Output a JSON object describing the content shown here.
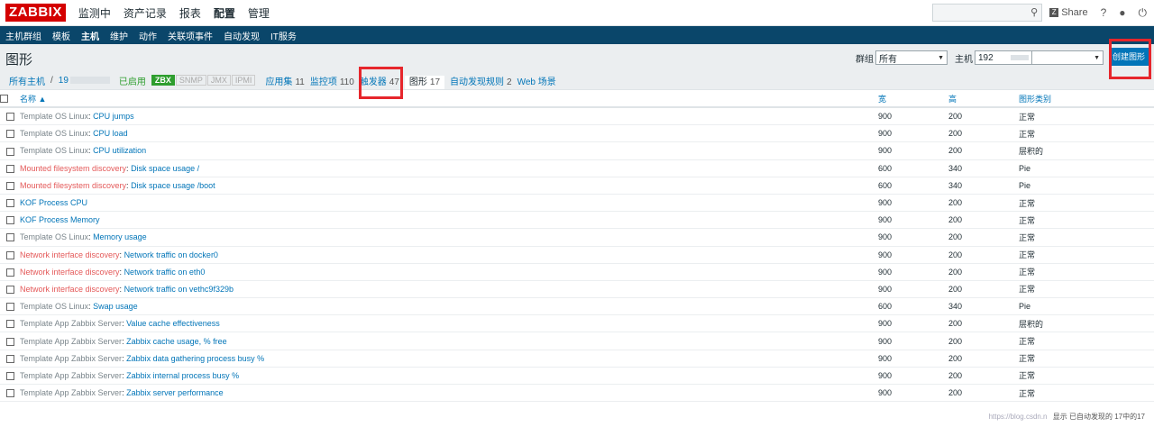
{
  "brand": {
    "logo": "ZABBIX",
    "color": "#d40000"
  },
  "main_menu": [
    {
      "label": "监测中",
      "active": false
    },
    {
      "label": "资产记录",
      "active": false
    },
    {
      "label": "报表",
      "active": false
    },
    {
      "label": "配置",
      "active": true
    },
    {
      "label": "管理",
      "active": false
    }
  ],
  "top_right": {
    "share": "Share",
    "help": "?",
    "search_icon": "search-icon",
    "user_icon": "user-icon",
    "power_icon": "power-icon"
  },
  "sub_menu": [
    {
      "label": "主机群组",
      "active": false
    },
    {
      "label": "模板",
      "active": false
    },
    {
      "label": "主机",
      "active": true
    },
    {
      "label": "维护",
      "active": false
    },
    {
      "label": "动作",
      "active": false
    },
    {
      "label": "关联项事件",
      "active": false
    },
    {
      "label": "自动发现",
      "active": false
    },
    {
      "label": "IT服务",
      "active": false
    }
  ],
  "header": {
    "title": "图形",
    "group_label": "群组",
    "group_value": "所有",
    "host_label": "主机",
    "host_value": "192",
    "create_button": "创建图形"
  },
  "breadcrumbs": {
    "all_hosts": "所有主机",
    "separator": "/",
    "host": "19",
    "enabled": "已启用",
    "badges": [
      {
        "label": "ZBX",
        "on": true
      },
      {
        "label": "SNMP",
        "on": false
      },
      {
        "label": "JMX",
        "on": false
      },
      {
        "label": "IPMI",
        "on": false
      }
    ],
    "items": [
      {
        "label": "应用集",
        "count": "11",
        "active": false
      },
      {
        "label": "监控项",
        "count": "110",
        "active": false
      },
      {
        "label": "触发器",
        "count": "47",
        "active": false
      },
      {
        "label": "图形",
        "count": "17",
        "active": true
      },
      {
        "label": "自动发现规则",
        "count": "2",
        "active": false
      },
      {
        "label": "Web 场景",
        "count": "",
        "active": false
      }
    ]
  },
  "table": {
    "columns": {
      "name": "名称 ▲",
      "width": "宽",
      "height": "高",
      "type": "图形类别"
    },
    "rows": [
      {
        "prefix": "Template OS Linux",
        "prefix_red": false,
        "name": "CPU jumps",
        "width": "900",
        "height": "200",
        "type": "正常"
      },
      {
        "prefix": "Template OS Linux",
        "prefix_red": false,
        "name": "CPU load",
        "width": "900",
        "height": "200",
        "type": "正常"
      },
      {
        "prefix": "Template OS Linux",
        "prefix_red": false,
        "name": "CPU utilization",
        "width": "900",
        "height": "200",
        "type": "层积的"
      },
      {
        "prefix": "Mounted filesystem discovery",
        "prefix_red": true,
        "name": "Disk space usage /",
        "width": "600",
        "height": "340",
        "type": "Pie"
      },
      {
        "prefix": "Mounted filesystem discovery",
        "prefix_red": true,
        "name": "Disk space usage /boot",
        "width": "600",
        "height": "340",
        "type": "Pie"
      },
      {
        "prefix": "",
        "prefix_red": false,
        "name": "KOF Process CPU",
        "width": "900",
        "height": "200",
        "type": "正常"
      },
      {
        "prefix": "",
        "prefix_red": false,
        "name": "KOF Process Memory",
        "width": "900",
        "height": "200",
        "type": "正常"
      },
      {
        "prefix": "Template OS Linux",
        "prefix_red": false,
        "name": "Memory usage",
        "width": "900",
        "height": "200",
        "type": "正常"
      },
      {
        "prefix": "Network interface discovery",
        "prefix_red": true,
        "name": "Network traffic on docker0",
        "width": "900",
        "height": "200",
        "type": "正常"
      },
      {
        "prefix": "Network interface discovery",
        "prefix_red": true,
        "name": "Network traffic on eth0",
        "width": "900",
        "height": "200",
        "type": "正常"
      },
      {
        "prefix": "Network interface discovery",
        "prefix_red": true,
        "name": "Network traffic on vethc9f329b",
        "width": "900",
        "height": "200",
        "type": "正常"
      },
      {
        "prefix": "Template OS Linux",
        "prefix_red": false,
        "name": "Swap usage",
        "width": "600",
        "height": "340",
        "type": "Pie"
      },
      {
        "prefix": "Template App Zabbix Server",
        "prefix_red": false,
        "name": "Value cache effectiveness",
        "width": "900",
        "height": "200",
        "type": "层积的"
      },
      {
        "prefix": "Template App Zabbix Server",
        "prefix_red": false,
        "name": "Zabbix cache usage, % free",
        "width": "900",
        "height": "200",
        "type": "正常"
      },
      {
        "prefix": "Template App Zabbix Server",
        "prefix_red": false,
        "name": "Zabbix data gathering process busy %",
        "width": "900",
        "height": "200",
        "type": "正常"
      },
      {
        "prefix": "Template App Zabbix Server",
        "prefix_red": false,
        "name": "Zabbix internal process busy %",
        "width": "900",
        "height": "200",
        "type": "正常"
      },
      {
        "prefix": "Template App Zabbix Server",
        "prefix_red": false,
        "name": "Zabbix server performance",
        "width": "900",
        "height": "200",
        "type": "正常"
      }
    ]
  },
  "footer": {
    "watermark": "https://blog.csdn.n",
    "summary": "显示 已自动发现的 17中的17"
  },
  "colors": {
    "nav": "#0a466a",
    "link": "#0275b8",
    "highlight_box": "#e6262c",
    "enabled": "#2e9e2e",
    "discovery_prefix": "#e45959"
  }
}
